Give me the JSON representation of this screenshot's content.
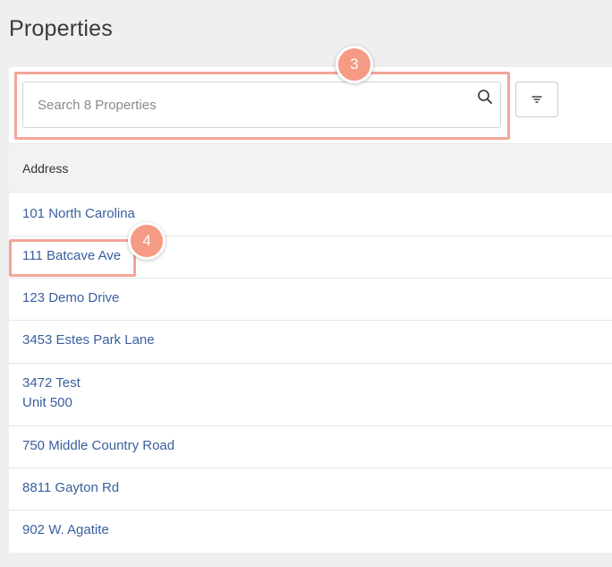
{
  "page": {
    "title": "Properties"
  },
  "search": {
    "placeholder": "Search 8 Properties",
    "value": ""
  },
  "filter": {
    "icon": "filter-lines-icon"
  },
  "table": {
    "column_header": "Address",
    "rows": [
      {
        "line1": "101 North Carolina",
        "line2": ""
      },
      {
        "line1": "111 Batcave Ave",
        "line2": ""
      },
      {
        "line1": "123 Demo Drive",
        "line2": ""
      },
      {
        "line1": "3453 Estes Park Lane",
        "line2": ""
      },
      {
        "line1": "3472 Test",
        "line2": "Unit 500"
      },
      {
        "line1": "750 Middle Country Road",
        "line2": ""
      },
      {
        "line1": "8811 Gayton Rd",
        "line2": ""
      },
      {
        "line1": "902 W. Agatite",
        "line2": ""
      }
    ]
  },
  "annotations": {
    "search_badge": "3",
    "row_badge": "4"
  },
  "colors": {
    "link": "#3a5f9e",
    "annotation": "#f59a85",
    "annotation_border": "#f3a597",
    "background": "#efefef",
    "header_background": "#f2f2f2"
  }
}
